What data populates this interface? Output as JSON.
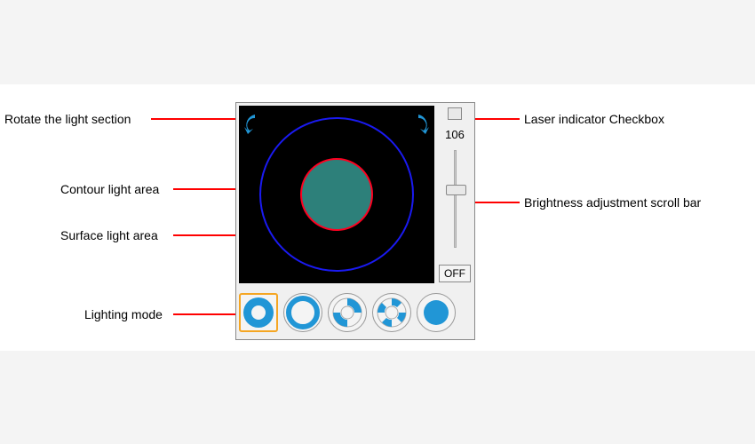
{
  "annotations": {
    "rotate": "Rotate the light section",
    "contour": "Contour light area",
    "surface": "Surface light area",
    "mode": "Lighting mode",
    "laser": "Laser indicator Checkbox",
    "brightness": "Brightness adjustment scroll bar"
  },
  "controls": {
    "value": "106",
    "off_label": "OFF"
  },
  "colors": {
    "accent": "#2196d6",
    "contour_fill": "#2d807a",
    "contour_stroke": "#ff0020",
    "surface_stroke": "#1a1af0"
  }
}
